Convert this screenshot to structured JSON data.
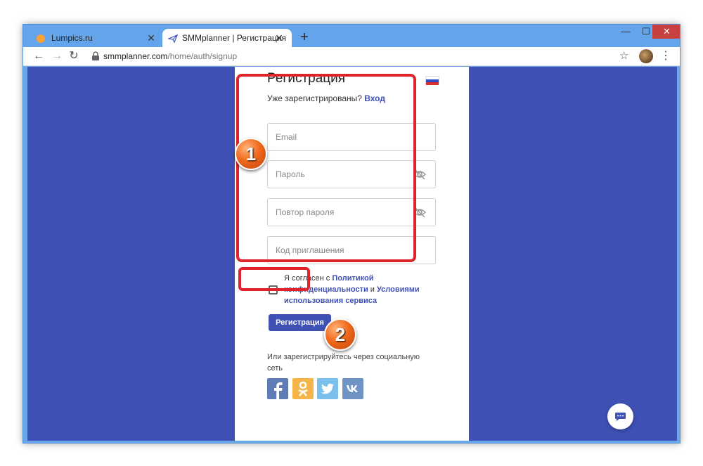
{
  "browser": {
    "tabs": [
      {
        "title": "Lumpics.ru",
        "icon": "orange-circle-icon"
      },
      {
        "title": "SMMplanner | Регистрация",
        "icon": "paper-plane-icon",
        "active": true
      }
    ],
    "new_tab": "+",
    "window_controls": {
      "minimize": "—",
      "maximize": "☐",
      "close": "✕"
    },
    "url_host": "smmplanner.com",
    "url_path": "/home/auth/signup",
    "nav": {
      "back": "←",
      "forward": "→",
      "reload": "↻"
    },
    "star": "☆",
    "menu": "⋮"
  },
  "form": {
    "title": "Регистрация",
    "registered_text": "Уже зарегистрированы?",
    "login_link": "Вход",
    "email_placeholder": "Email",
    "password_placeholder": "Пароль",
    "password_repeat_placeholder": "Повтор пароля",
    "invite_placeholder": "Код приглашения",
    "agree": {
      "prefix": "Я согласен с",
      "link1": "Политикой конфиденциальности",
      "middle": "и",
      "link2": "Условиями использования сервиса"
    },
    "submit_label": "Регистрация",
    "social_text": "Или зарегистрируйтесь через социальную сеть"
  },
  "annotations": {
    "badge1": "1",
    "badge2": "2"
  },
  "colors": {
    "brand": "#3f51b5",
    "highlight": "#e0232b"
  }
}
